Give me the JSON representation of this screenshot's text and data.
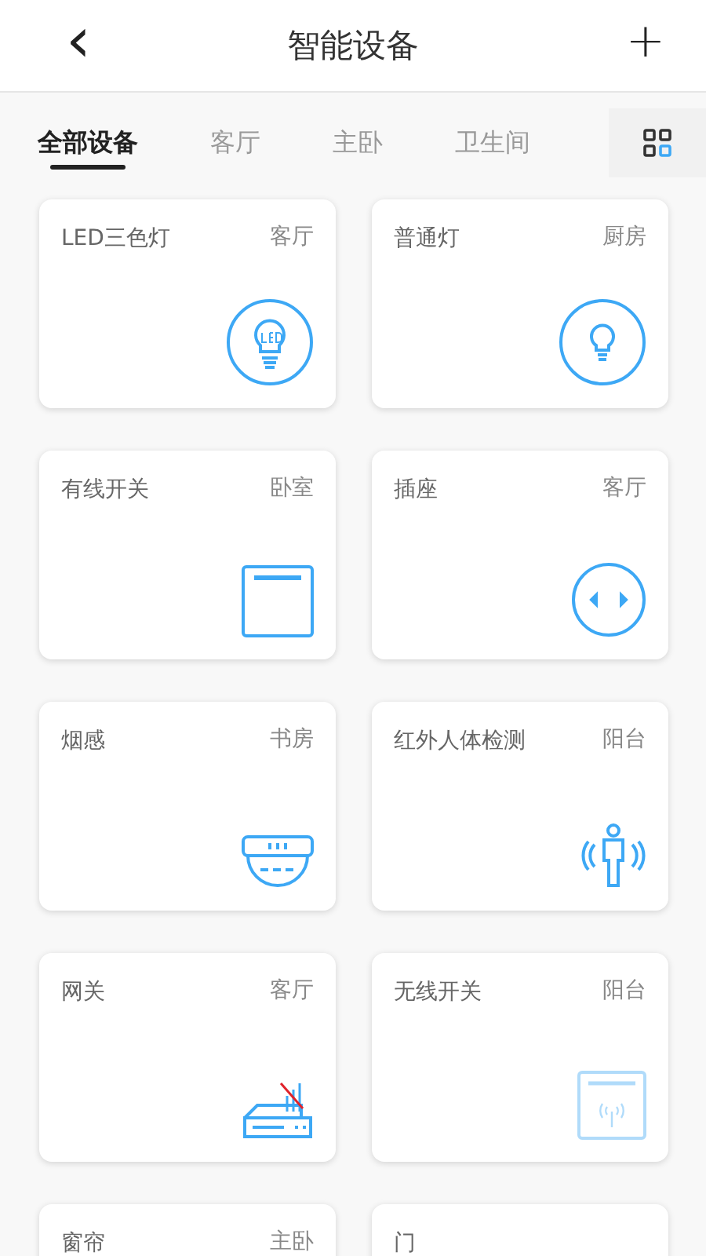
{
  "header": {
    "back": "‹",
    "title": "智能设备",
    "add": "+"
  },
  "tabs": [
    {
      "label": "全部设备",
      "selected": true
    },
    {
      "label": "客厅",
      "selected": false
    },
    {
      "label": "主卧",
      "selected": false
    },
    {
      "label": "卫生间",
      "selected": false
    }
  ],
  "devices": [
    {
      "name": "LED三色灯",
      "room": "客厅",
      "kind": "led",
      "disabled": false
    },
    {
      "name": "普通灯",
      "room": "厨房",
      "kind": "bulb",
      "disabled": false
    },
    {
      "name": "有线开关",
      "room": "卧室",
      "kind": "switch",
      "disabled": false
    },
    {
      "name": "插座",
      "room": "客厅",
      "kind": "socket",
      "disabled": false
    },
    {
      "name": "烟感",
      "room": "书房",
      "kind": "smoke",
      "disabled": false
    },
    {
      "name": "红外人体检测",
      "room": "阳台",
      "kind": "motion",
      "disabled": false
    },
    {
      "name": "网关",
      "room": "客厅",
      "kind": "gateway",
      "disabled": false
    },
    {
      "name": "无线开关",
      "room": "阳台",
      "kind": "wireless",
      "disabled": true
    },
    {
      "name": "窗帘",
      "room": "主卧",
      "kind": "none",
      "disabled": false
    },
    {
      "name": "门",
      "kind": "none",
      "disabled": false
    }
  ]
}
